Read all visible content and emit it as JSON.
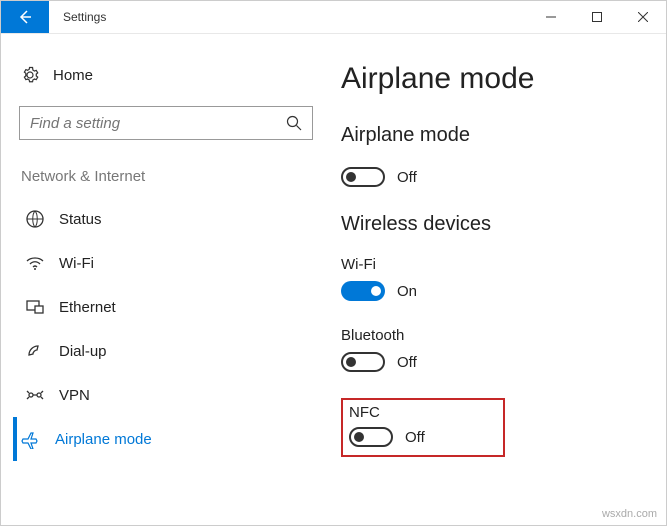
{
  "window": {
    "title": "Settings"
  },
  "sidebar": {
    "home_label": "Home",
    "search_placeholder": "Find a setting",
    "section_label": "Network & Internet",
    "items": [
      {
        "label": "Status"
      },
      {
        "label": "Wi-Fi"
      },
      {
        "label": "Ethernet"
      },
      {
        "label": "Dial-up"
      },
      {
        "label": "VPN"
      },
      {
        "label": "Airplane mode"
      }
    ]
  },
  "main": {
    "page_title": "Airplane mode",
    "airplane_heading": "Airplane mode",
    "airplane_state": "Off",
    "wireless_heading": "Wireless devices",
    "wifi_label": "Wi-Fi",
    "wifi_state": "On",
    "bt_label": "Bluetooth",
    "bt_state": "Off",
    "nfc_label": "NFC",
    "nfc_state": "Off"
  },
  "watermark": "wsxdn.com"
}
